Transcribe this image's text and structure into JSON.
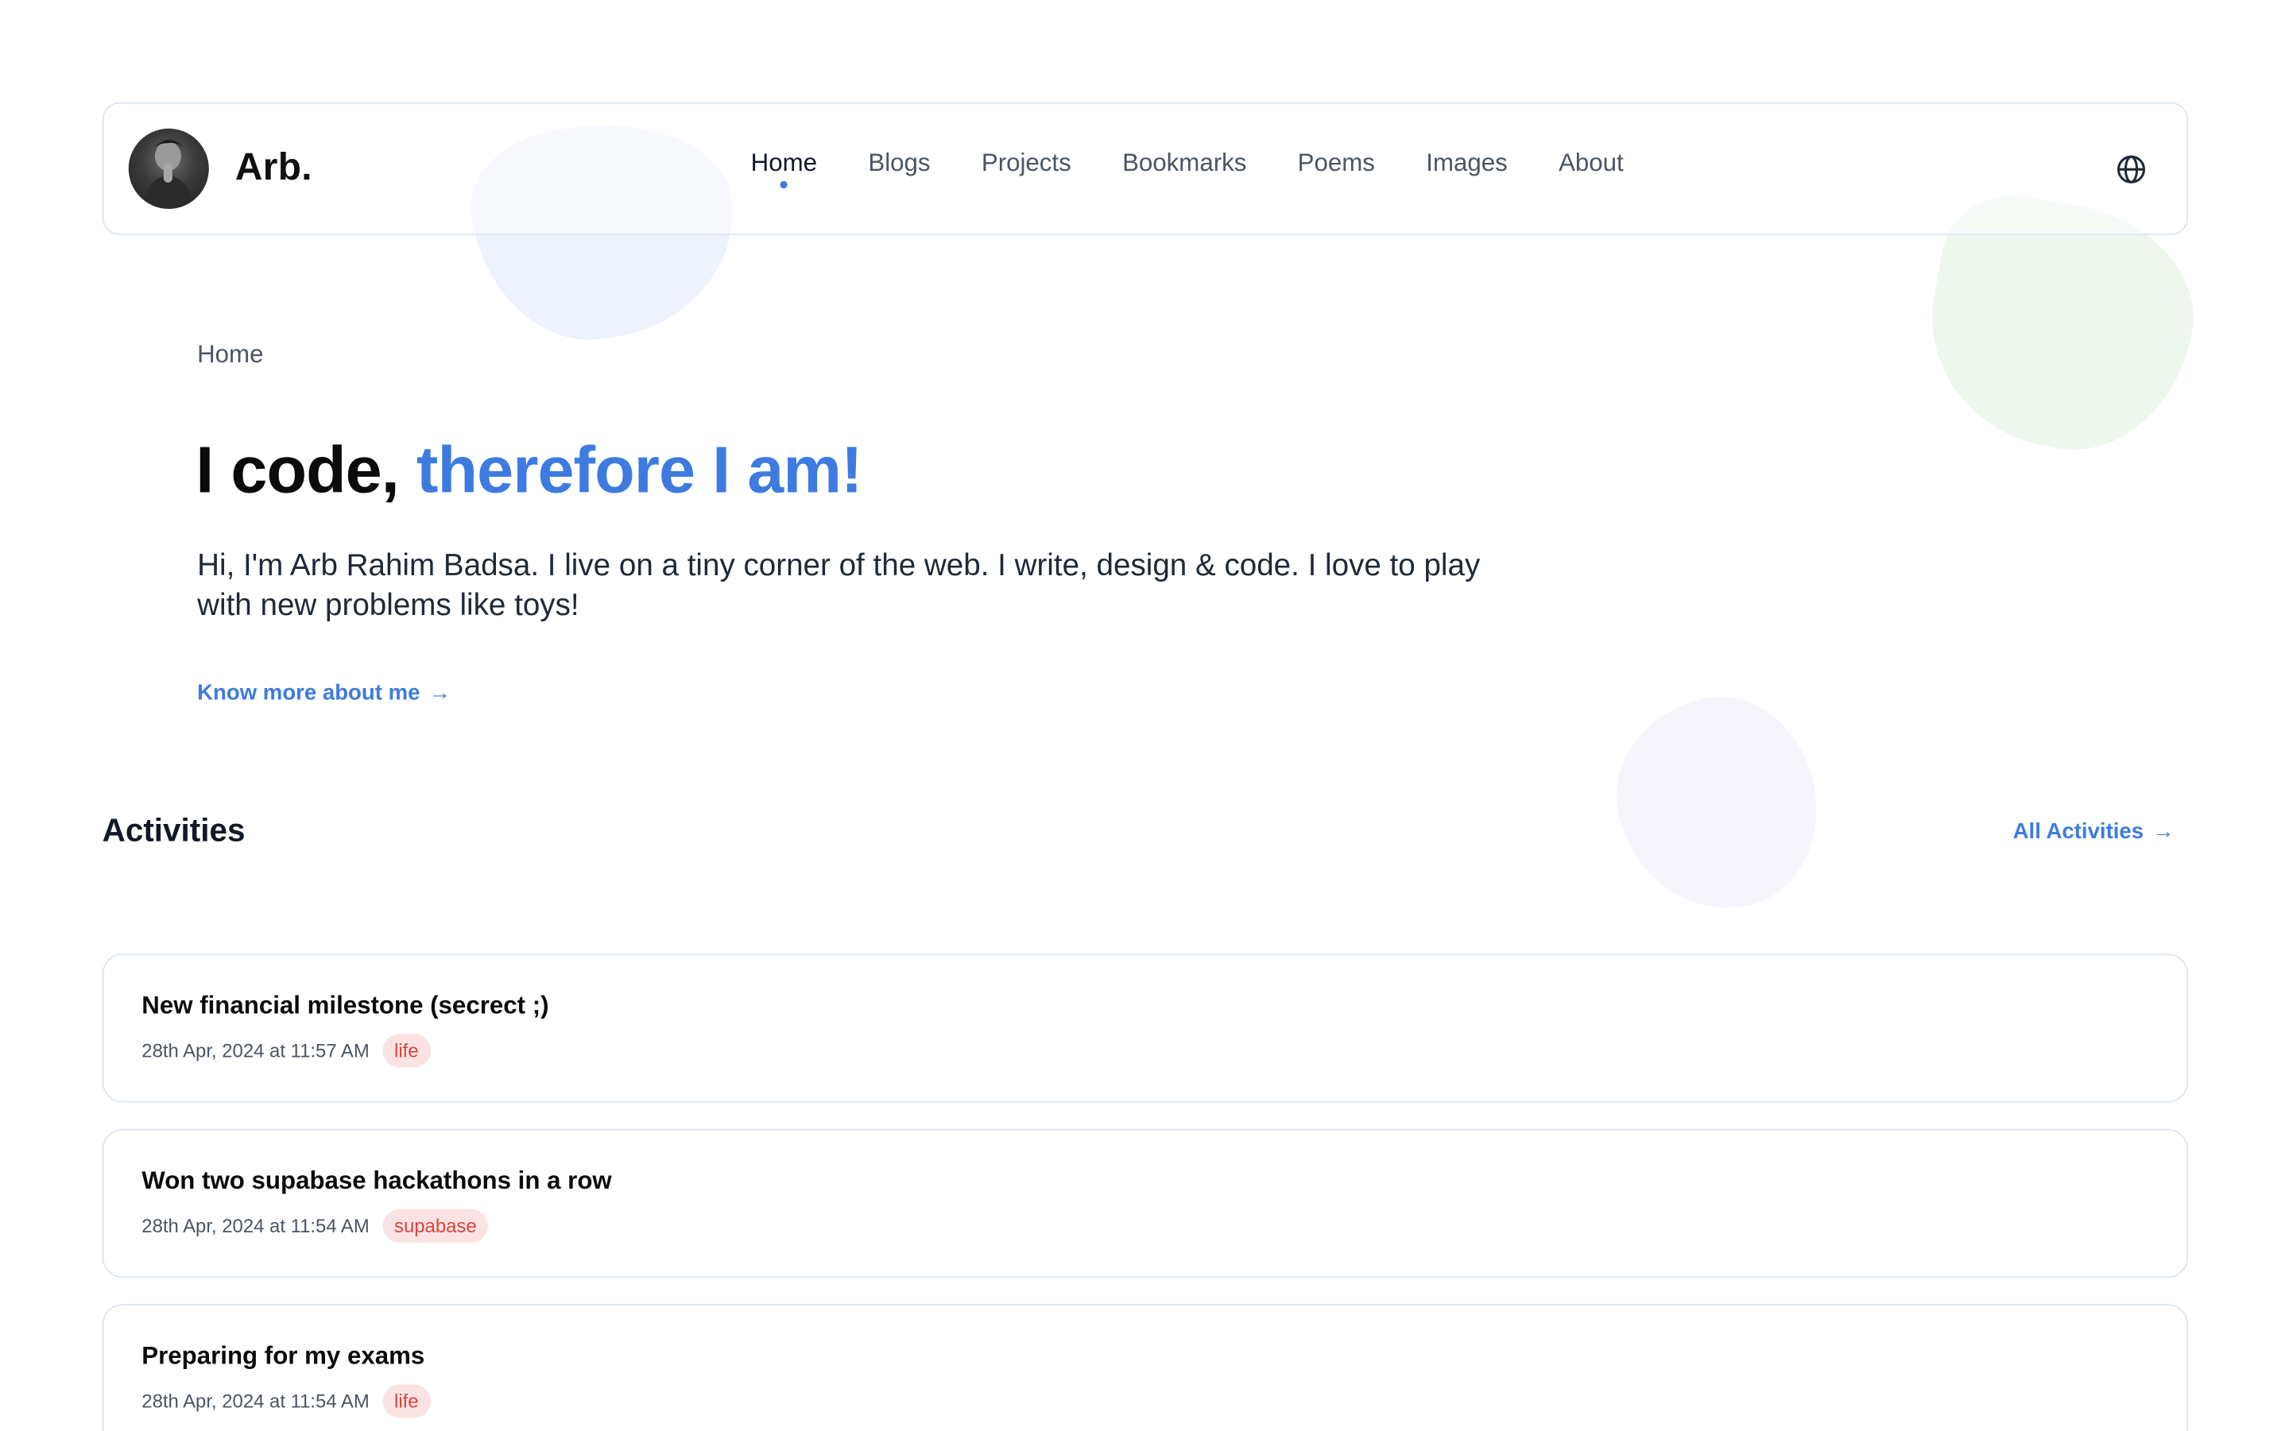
{
  "header": {
    "brand": "Arb.",
    "nav": [
      {
        "label": "Home",
        "active": true
      },
      {
        "label": "Blogs",
        "active": false
      },
      {
        "label": "Projects",
        "active": false
      },
      {
        "label": "Bookmarks",
        "active": false
      },
      {
        "label": "Poems",
        "active": false
      },
      {
        "label": "Images",
        "active": false
      },
      {
        "label": "About",
        "active": false
      }
    ],
    "language_icon": "globe-icon"
  },
  "hero": {
    "breadcrumb": "Home",
    "title_main": "I code, ",
    "title_accent": "therefore I am!",
    "intro": "Hi, I'm Arb Rahim Badsa. I live on a tiny corner of the web. I write, design & code. I love to play with new problems like toys!",
    "cta_label": "Know more about me"
  },
  "activities": {
    "heading": "Activities",
    "all_label": "All Activities",
    "items": [
      {
        "title": "New financial milestone (secrect ;)",
        "date": "28th Apr, 2024 at 11:57 AM",
        "tag": "life"
      },
      {
        "title": "Won two supabase hackathons in a row",
        "date": "28th Apr, 2024 at 11:54 AM",
        "tag": "supabase"
      },
      {
        "title": "Preparing for my exams",
        "date": "28th Apr, 2024 at 11:54 AM",
        "tag": "life"
      }
    ]
  },
  "colors": {
    "accent": "#3d7be0",
    "tag_text": "#d9433f",
    "tag_bg": "#fbe3e3",
    "border": "#dde5f2"
  }
}
